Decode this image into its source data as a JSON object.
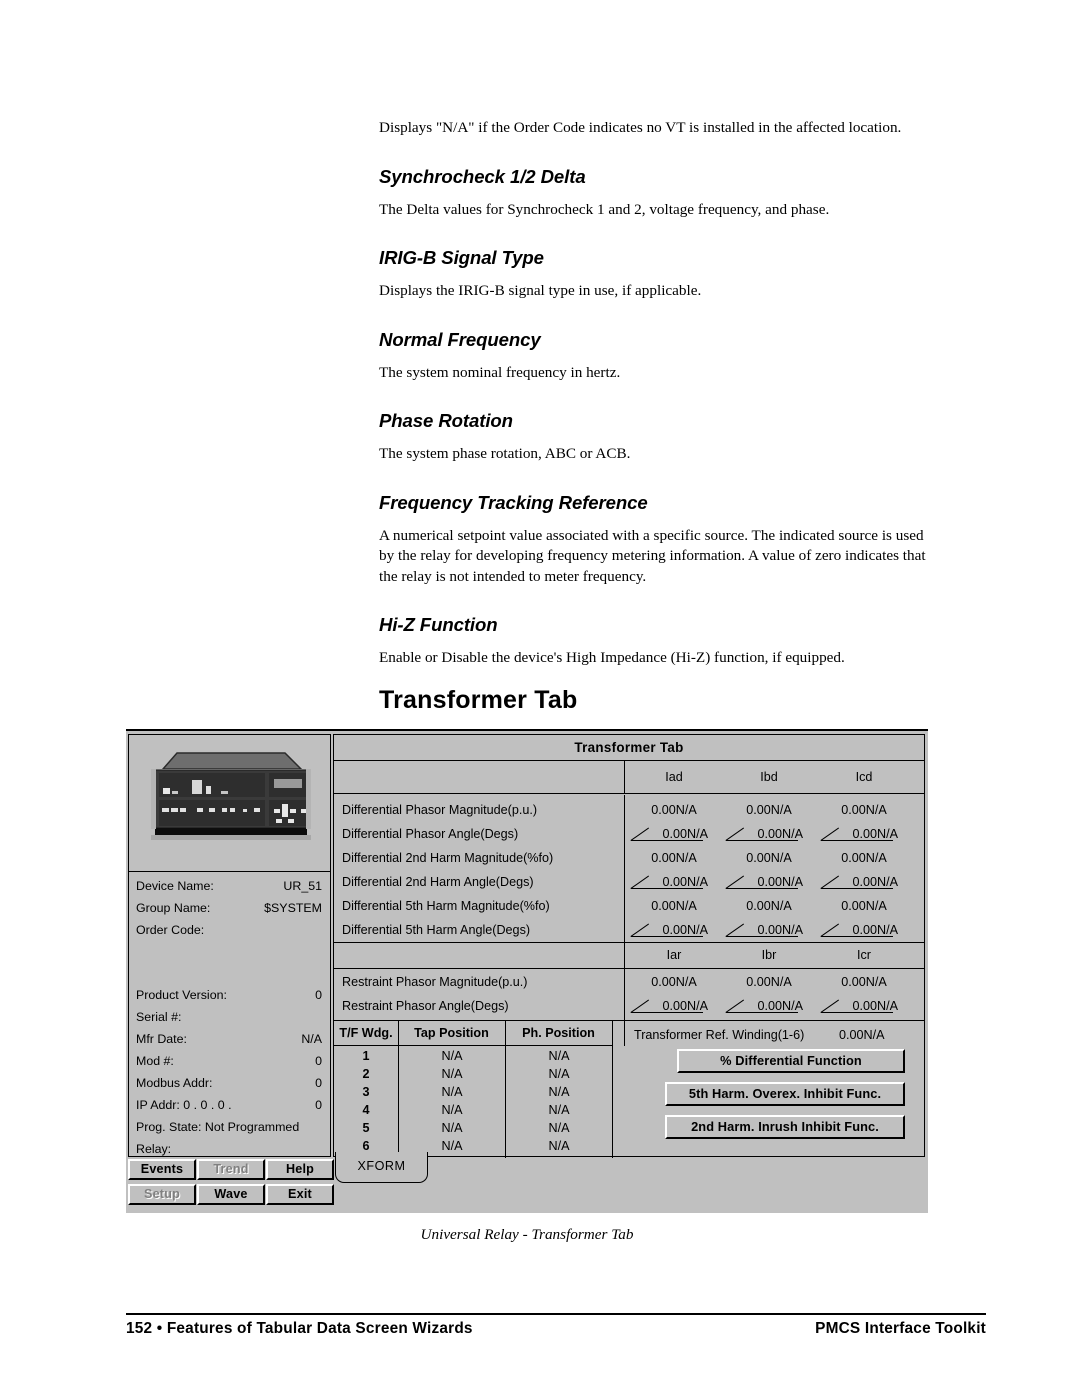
{
  "prose": {
    "intro": "Displays \"N/A\" if the Order Code indicates no VT is installed in the affected location.",
    "sections": [
      {
        "heading": "Synchrocheck 1/2 Delta",
        "body": "The Delta values for Synchrocheck 1 and 2, voltage frequency, and phase."
      },
      {
        "heading": "IRIG-B Signal Type",
        "body": "Displays the IRIG-B signal type in use, if applicable."
      },
      {
        "heading": "Normal Frequency",
        "body": "The system nominal frequency in hertz."
      },
      {
        "heading": "Phase Rotation",
        "body": "The system phase rotation, ABC or ACB."
      },
      {
        "heading": "Frequency Tracking Reference",
        "body": "A numerical setpoint value associated with a specific source. The indicated source is used by the relay for developing frequency metering information. A value of zero indicates that the relay is not intended to meter frequency."
      },
      {
        "heading": "Hi-Z Function",
        "body": "Enable or Disable the device's High Impedance (Hi-Z) function, if equipped."
      }
    ]
  },
  "page_title": "Transformer Tab",
  "figure": {
    "caption": "Universal Relay - Transformer Tab",
    "window_title": "Transformer Tab",
    "device_panel": {
      "fields": [
        {
          "label": "Device Name:",
          "value": "UR_51"
        },
        {
          "label": "Group Name:",
          "value": "$SYSTEM"
        },
        {
          "label": "Order Code:",
          "value": ""
        },
        {
          "label": "",
          "value": ""
        },
        {
          "label": "Product Version:",
          "value": "0"
        },
        {
          "label": "Serial #:",
          "value": ""
        },
        {
          "label": "Mfr Date:",
          "value": "N/A"
        },
        {
          "label": "Mod #:",
          "value": "0"
        },
        {
          "label": "Modbus Addr:",
          "value": "0"
        },
        {
          "label": "IP Addr:   0 .    0 .    0 .",
          "value": "0"
        },
        {
          "label": "Prog. State: Not Programmed",
          "value": ""
        },
        {
          "label": "Relay:",
          "value": ""
        }
      ],
      "buttons": [
        {
          "label": "Events",
          "enabled": true
        },
        {
          "label": "Trend",
          "enabled": false
        },
        {
          "label": "Help",
          "enabled": true
        },
        {
          "label": "Setup",
          "enabled": false
        },
        {
          "label": "Wave",
          "enabled": true
        },
        {
          "label": "Exit",
          "enabled": true
        }
      ]
    },
    "differential": {
      "columns": [
        "Iad",
        "Ibd",
        "Icd"
      ],
      "rows": [
        {
          "label": "Differential Phasor Magnitude(p.u.)",
          "angle": false,
          "values": [
            "0.00N/A",
            "0.00N/A",
            "0.00N/A"
          ]
        },
        {
          "label": "Differential Phasor Angle(Degs)",
          "angle": true,
          "values": [
            "0.00N/A",
            "0.00N/A",
            "0.00N/A"
          ]
        },
        {
          "label": "Differential 2nd Harm Magnitude(%fo)",
          "angle": false,
          "values": [
            "0.00N/A",
            "0.00N/A",
            "0.00N/A"
          ]
        },
        {
          "label": "Differential 2nd Harm Angle(Degs)",
          "angle": true,
          "values": [
            "0.00N/A",
            "0.00N/A",
            "0.00N/A"
          ]
        },
        {
          "label": "Differential 5th Harm Magnitude(%fo)",
          "angle": false,
          "values": [
            "0.00N/A",
            "0.00N/A",
            "0.00N/A"
          ]
        },
        {
          "label": "Differential 5th Harm Angle(Degs)",
          "angle": true,
          "values": [
            "0.00N/A",
            "0.00N/A",
            "0.00N/A"
          ]
        }
      ]
    },
    "restraint": {
      "columns": [
        "Iar",
        "Ibr",
        "Icr"
      ],
      "rows": [
        {
          "label": "Restraint Phasor Magnitude(p.u.)",
          "angle": false,
          "values": [
            "0.00N/A",
            "0.00N/A",
            "0.00N/A"
          ]
        },
        {
          "label": "Restraint Phasor Angle(Degs)",
          "angle": true,
          "values": [
            "0.00N/A",
            "0.00N/A",
            "0.00N/A"
          ]
        }
      ]
    },
    "winding_table": {
      "headers": [
        "T/F Wdg.",
        "Tap Position",
        "Ph. Position"
      ],
      "rows": [
        {
          "wdg": "1",
          "tap": "N/A",
          "ph": "N/A"
        },
        {
          "wdg": "2",
          "tap": "N/A",
          "ph": "N/A"
        },
        {
          "wdg": "3",
          "tap": "N/A",
          "ph": "N/A"
        },
        {
          "wdg": "4",
          "tap": "N/A",
          "ph": "N/A"
        },
        {
          "wdg": "5",
          "tap": "N/A",
          "ph": "N/A"
        },
        {
          "wdg": "6",
          "tap": "N/A",
          "ph": "N/A"
        }
      ]
    },
    "ref_winding": {
      "label": "Transformer Ref. Winding(1-6)",
      "value": "0.00N/A"
    },
    "function_buttons": [
      "% Differential Function",
      "5th Harm. Overex. Inhibit Func.",
      "2nd Harm. Inrush Inhibit Func."
    ],
    "tab_label": "XFORM"
  },
  "footer": {
    "left": "152 • Features of Tabular Data Screen Wizards",
    "right": "PMCS Interface Toolkit"
  }
}
